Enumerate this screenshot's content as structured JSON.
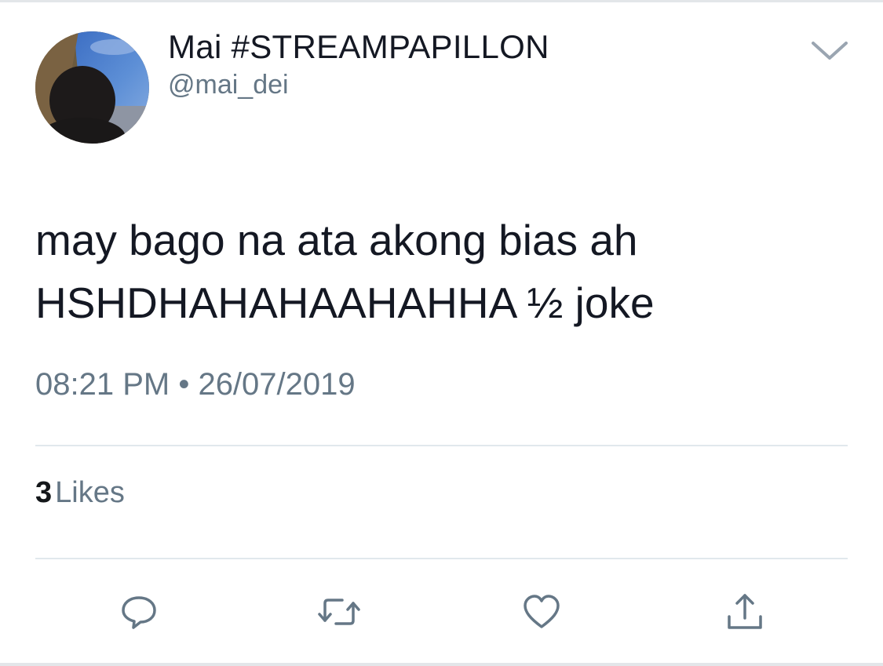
{
  "tweet": {
    "author": {
      "display_name": "Mai #STREAMPAPILLON",
      "handle": "@mai_dei",
      "avatar_icon": "profile-photo"
    },
    "menu_icon": "chevron-down-icon",
    "text_lines": [
      "may bago na ata akong bias ah",
      "HSHDHAHAHAAHAHHA ½ joke"
    ],
    "timestamp": "08:21 PM • 26/07/2019",
    "likes": {
      "count": "3",
      "label": "Likes"
    },
    "actions": [
      {
        "name": "reply",
        "icon": "reply-icon"
      },
      {
        "name": "retweet",
        "icon": "retweet-icon"
      },
      {
        "name": "like",
        "icon": "heart-icon"
      },
      {
        "name": "share",
        "icon": "share-icon"
      }
    ]
  },
  "colors": {
    "primary_text": "#141823",
    "secondary_text": "#657786",
    "divider": "#e1e8ed",
    "icon": "#657786"
  }
}
